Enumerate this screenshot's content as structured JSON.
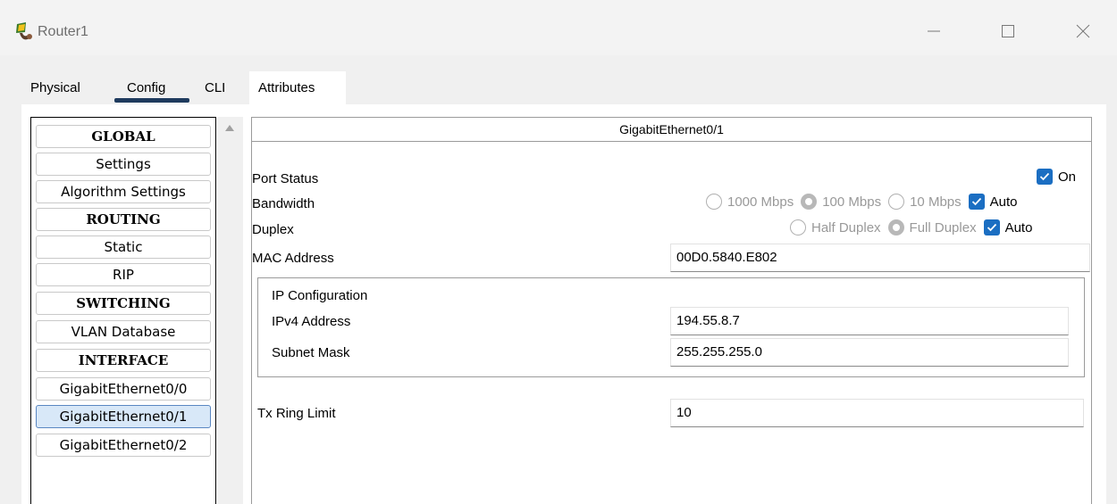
{
  "window": {
    "title": "Router1"
  },
  "tabs": [
    {
      "label": "Physical"
    },
    {
      "label": "Config"
    },
    {
      "label": "CLI"
    },
    {
      "label": "Attributes"
    }
  ],
  "nav": {
    "items": [
      {
        "label": "GLOBAL",
        "type": "section"
      },
      {
        "label": "Settings",
        "type": "item"
      },
      {
        "label": "Algorithm Settings",
        "type": "item"
      },
      {
        "label": "ROUTING",
        "type": "section"
      },
      {
        "label": "Static",
        "type": "item"
      },
      {
        "label": "RIP",
        "type": "item"
      },
      {
        "label": "SWITCHING",
        "type": "section"
      },
      {
        "label": "VLAN Database",
        "type": "item"
      },
      {
        "label": "INTERFACE",
        "type": "section"
      },
      {
        "label": "GigabitEthernet0/0",
        "type": "item"
      },
      {
        "label": "GigabitEthernet0/1",
        "type": "item",
        "selected": true
      },
      {
        "label": "GigabitEthernet0/2",
        "type": "item"
      }
    ]
  },
  "panel": {
    "header": "GigabitEthernet0/1",
    "port_status": {
      "label": "Port Status",
      "on_label": "On",
      "on_checked": true
    },
    "bandwidth": {
      "label": "Bandwidth",
      "opt_1000": "1000 Mbps",
      "opt_100": "100 Mbps",
      "opt_10": "10 Mbps",
      "auto": "Auto",
      "selected": "100 Mbps",
      "auto_checked": true
    },
    "duplex": {
      "label": "Duplex",
      "half": "Half Duplex",
      "full": "Full Duplex",
      "auto": "Auto",
      "selected": "Full Duplex",
      "auto_checked": true
    },
    "mac": {
      "label": "MAC Address",
      "value": "00D0.5840.E802"
    },
    "ip_config": {
      "title": "IP Configuration",
      "ipv4_label": "IPv4 Address",
      "ipv4_value": "194.55.8.7",
      "mask_label": "Subnet Mask",
      "mask_value": "255.255.255.0"
    },
    "tx_ring": {
      "label": "Tx Ring Limit",
      "value": "10"
    }
  },
  "colors": {
    "accent": "#1b6ec2",
    "tab_underline": "#1f3b5e",
    "selected_bg": "#d8e8f8"
  }
}
